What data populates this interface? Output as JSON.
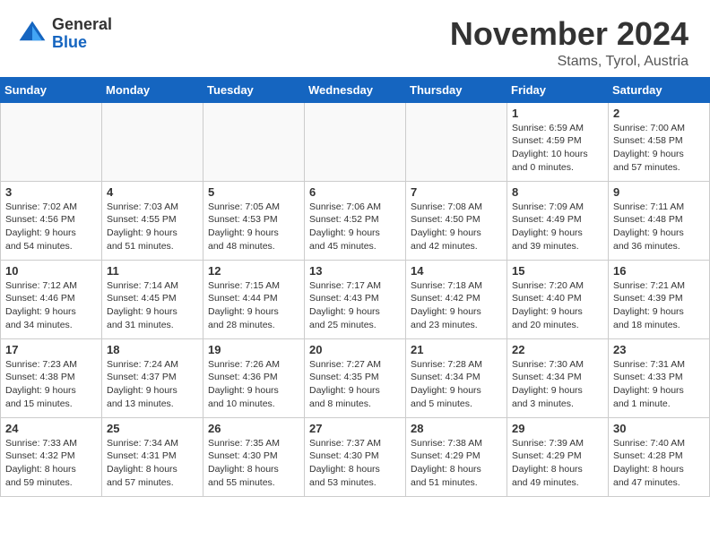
{
  "header": {
    "logo_general": "General",
    "logo_blue": "Blue",
    "month_title": "November 2024",
    "location": "Stams, Tyrol, Austria"
  },
  "weekdays": [
    "Sunday",
    "Monday",
    "Tuesday",
    "Wednesday",
    "Thursday",
    "Friday",
    "Saturday"
  ],
  "weeks": [
    [
      {
        "day": "",
        "info": ""
      },
      {
        "day": "",
        "info": ""
      },
      {
        "day": "",
        "info": ""
      },
      {
        "day": "",
        "info": ""
      },
      {
        "day": "",
        "info": ""
      },
      {
        "day": "1",
        "info": "Sunrise: 6:59 AM\nSunset: 4:59 PM\nDaylight: 10 hours\nand 0 minutes."
      },
      {
        "day": "2",
        "info": "Sunrise: 7:00 AM\nSunset: 4:58 PM\nDaylight: 9 hours\nand 57 minutes."
      }
    ],
    [
      {
        "day": "3",
        "info": "Sunrise: 7:02 AM\nSunset: 4:56 PM\nDaylight: 9 hours\nand 54 minutes."
      },
      {
        "day": "4",
        "info": "Sunrise: 7:03 AM\nSunset: 4:55 PM\nDaylight: 9 hours\nand 51 minutes."
      },
      {
        "day": "5",
        "info": "Sunrise: 7:05 AM\nSunset: 4:53 PM\nDaylight: 9 hours\nand 48 minutes."
      },
      {
        "day": "6",
        "info": "Sunrise: 7:06 AM\nSunset: 4:52 PM\nDaylight: 9 hours\nand 45 minutes."
      },
      {
        "day": "7",
        "info": "Sunrise: 7:08 AM\nSunset: 4:50 PM\nDaylight: 9 hours\nand 42 minutes."
      },
      {
        "day": "8",
        "info": "Sunrise: 7:09 AM\nSunset: 4:49 PM\nDaylight: 9 hours\nand 39 minutes."
      },
      {
        "day": "9",
        "info": "Sunrise: 7:11 AM\nSunset: 4:48 PM\nDaylight: 9 hours\nand 36 minutes."
      }
    ],
    [
      {
        "day": "10",
        "info": "Sunrise: 7:12 AM\nSunset: 4:46 PM\nDaylight: 9 hours\nand 34 minutes."
      },
      {
        "day": "11",
        "info": "Sunrise: 7:14 AM\nSunset: 4:45 PM\nDaylight: 9 hours\nand 31 minutes."
      },
      {
        "day": "12",
        "info": "Sunrise: 7:15 AM\nSunset: 4:44 PM\nDaylight: 9 hours\nand 28 minutes."
      },
      {
        "day": "13",
        "info": "Sunrise: 7:17 AM\nSunset: 4:43 PM\nDaylight: 9 hours\nand 25 minutes."
      },
      {
        "day": "14",
        "info": "Sunrise: 7:18 AM\nSunset: 4:42 PM\nDaylight: 9 hours\nand 23 minutes."
      },
      {
        "day": "15",
        "info": "Sunrise: 7:20 AM\nSunset: 4:40 PM\nDaylight: 9 hours\nand 20 minutes."
      },
      {
        "day": "16",
        "info": "Sunrise: 7:21 AM\nSunset: 4:39 PM\nDaylight: 9 hours\nand 18 minutes."
      }
    ],
    [
      {
        "day": "17",
        "info": "Sunrise: 7:23 AM\nSunset: 4:38 PM\nDaylight: 9 hours\nand 15 minutes."
      },
      {
        "day": "18",
        "info": "Sunrise: 7:24 AM\nSunset: 4:37 PM\nDaylight: 9 hours\nand 13 minutes."
      },
      {
        "day": "19",
        "info": "Sunrise: 7:26 AM\nSunset: 4:36 PM\nDaylight: 9 hours\nand 10 minutes."
      },
      {
        "day": "20",
        "info": "Sunrise: 7:27 AM\nSunset: 4:35 PM\nDaylight: 9 hours\nand 8 minutes."
      },
      {
        "day": "21",
        "info": "Sunrise: 7:28 AM\nSunset: 4:34 PM\nDaylight: 9 hours\nand 5 minutes."
      },
      {
        "day": "22",
        "info": "Sunrise: 7:30 AM\nSunset: 4:34 PM\nDaylight: 9 hours\nand 3 minutes."
      },
      {
        "day": "23",
        "info": "Sunrise: 7:31 AM\nSunset: 4:33 PM\nDaylight: 9 hours\nand 1 minute."
      }
    ],
    [
      {
        "day": "24",
        "info": "Sunrise: 7:33 AM\nSunset: 4:32 PM\nDaylight: 8 hours\nand 59 minutes."
      },
      {
        "day": "25",
        "info": "Sunrise: 7:34 AM\nSunset: 4:31 PM\nDaylight: 8 hours\nand 57 minutes."
      },
      {
        "day": "26",
        "info": "Sunrise: 7:35 AM\nSunset: 4:30 PM\nDaylight: 8 hours\nand 55 minutes."
      },
      {
        "day": "27",
        "info": "Sunrise: 7:37 AM\nSunset: 4:30 PM\nDaylight: 8 hours\nand 53 minutes."
      },
      {
        "day": "28",
        "info": "Sunrise: 7:38 AM\nSunset: 4:29 PM\nDaylight: 8 hours\nand 51 minutes."
      },
      {
        "day": "29",
        "info": "Sunrise: 7:39 AM\nSunset: 4:29 PM\nDaylight: 8 hours\nand 49 minutes."
      },
      {
        "day": "30",
        "info": "Sunrise: 7:40 AM\nSunset: 4:28 PM\nDaylight: 8 hours\nand 47 minutes."
      }
    ]
  ]
}
